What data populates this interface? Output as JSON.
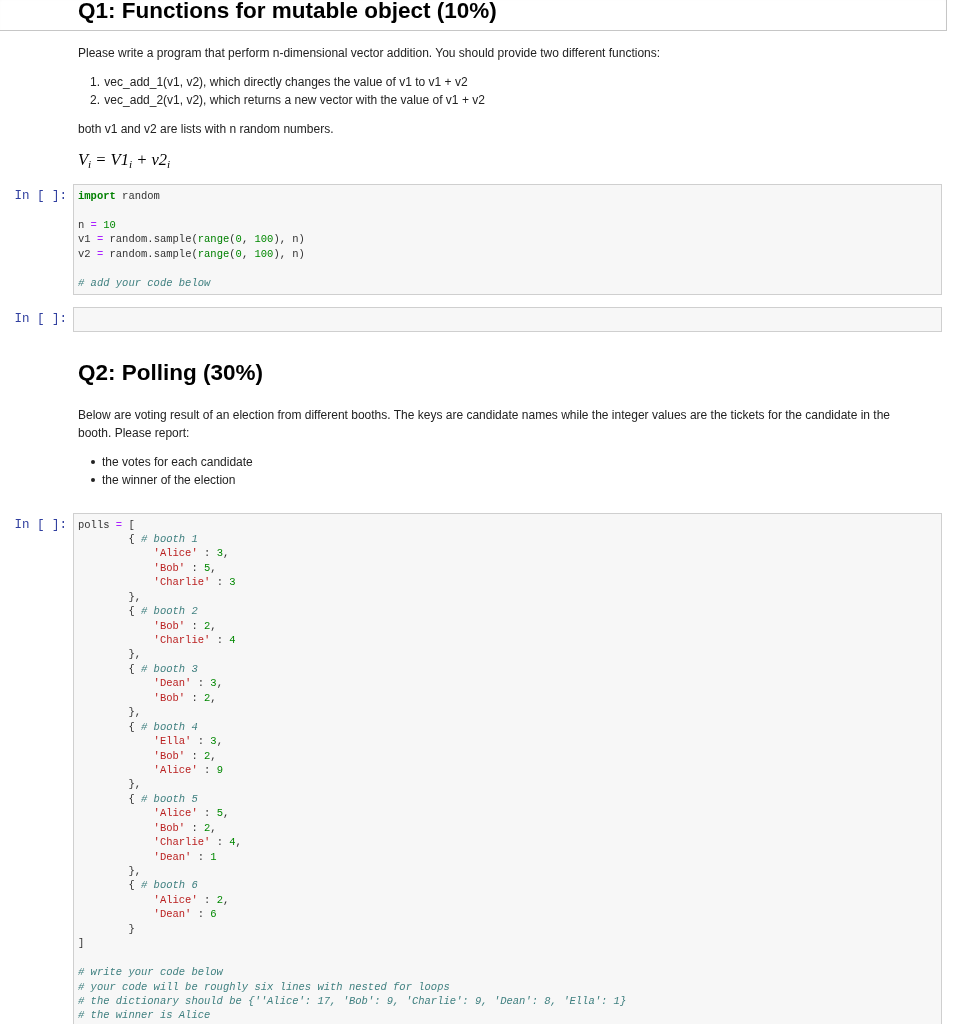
{
  "cells": [
    {
      "kind": "markdown",
      "selected": true,
      "blocks": [
        {
          "kind": "heading",
          "text": "Q1: Functions for mutable object (10%)"
        }
      ]
    },
    {
      "kind": "markdown",
      "selected": false,
      "blocks": [
        {
          "kind": "paragraph",
          "text": "Please write a program that perform n-dimensional vector addition. You should provide two different functions:"
        },
        {
          "kind": "numbered_list",
          "items": [
            {
              "marker": "1.",
              "text": "vec_add_1(v1, v2), which directly changes the value of v1 to v1 + v2"
            },
            {
              "marker": "2.",
              "text": "vec_add_2(v1, v2), which returns a new vector with the value of v1 + v2"
            }
          ]
        },
        {
          "kind": "paragraph",
          "text": "both v1 and v2 are lists with n random numbers."
        },
        {
          "kind": "math",
          "text": "V$_{i}$ = V1$_{i}$ + v2$_{i}$"
        }
      ]
    },
    {
      "kind": "code",
      "selected": false,
      "prompt": "In [ ]:",
      "blocks": [
        [
          [
            {
              "kind": "keyword",
              "text": "import"
            },
            {
              "kind": "plain",
              "text": " random"
            }
          ]
        ],
        [
          [
            {
              "kind": "plain",
              "text": "n "
            },
            {
              "kind": "operator",
              "text": "="
            },
            {
              "kind": "number",
              "text": " 10"
            }
          ],
          [
            {
              "kind": "plain",
              "text": "v1 "
            },
            {
              "kind": "operator",
              "text": "="
            },
            {
              "kind": "plain",
              "text": " random.sample("
            },
            {
              "kind": "builtin",
              "text": "range"
            },
            {
              "kind": "plain",
              "text": "("
            },
            {
              "kind": "number",
              "text": "0"
            },
            {
              "kind": "plain",
              "text": ", "
            },
            {
              "kind": "number",
              "text": "100"
            },
            {
              "kind": "plain",
              "text": "), n)"
            }
          ],
          [
            {
              "kind": "plain",
              "text": "v2 "
            },
            {
              "kind": "operator",
              "text": "="
            },
            {
              "kind": "plain",
              "text": " random.sample("
            },
            {
              "kind": "builtin",
              "text": "range"
            },
            {
              "kind": "plain",
              "text": "("
            },
            {
              "kind": "number",
              "text": "0"
            },
            {
              "kind": "plain",
              "text": ", "
            },
            {
              "kind": "number",
              "text": "100"
            },
            {
              "kind": "plain",
              "text": "), n)"
            }
          ]
        ],
        [
          [
            {
              "kind": "comment",
              "text": "# add your code below"
            }
          ]
        ]
      ]
    },
    {
      "kind": "code",
      "selected": false,
      "prompt": "In [ ]:"
    },
    {
      "kind": "markdown",
      "selected": false,
      "blocks": [
        {
          "kind": "heading",
          "text": "Q2: Polling (30%)"
        },
        {
          "kind": "paragraph",
          "text": "Below are voting result of an election from different booths. The keys are candidate names while the integer values are the tickets for the candidate in the booth. Please report:"
        },
        {
          "kind": "bullet_list",
          "items": [
            "the votes for each candidate",
            "the winner of the election"
          ]
        }
      ]
    },
    {
      "kind": "code",
      "selected": false,
      "prompt": "In [ ]:",
      "blocks": [
        [
          [
            {
              "kind": "plain",
              "text": "polls "
            },
            {
              "kind": "operator",
              "text": "="
            },
            {
              "kind": "plain",
              "text": " ["
            }
          ],
          [
            {
              "kind": "plain",
              "text": "        { "
            },
            {
              "kind": "comment",
              "text": "# booth 1"
            }
          ],
          [
            {
              "kind": "string",
              "text": "            'Alice'"
            },
            {
              "kind": "plain",
              "text": " : "
            },
            {
              "kind": "number",
              "text": "3"
            },
            {
              "kind": "plain",
              "text": ","
            }
          ],
          [
            {
              "kind": "string",
              "text": "            'Bob'"
            },
            {
              "kind": "plain",
              "text": " : "
            },
            {
              "kind": "number",
              "text": "5"
            },
            {
              "kind": "plain",
              "text": ","
            }
          ],
          [
            {
              "kind": "string",
              "text": "            'Charlie'"
            },
            {
              "kind": "plain",
              "text": " : "
            },
            {
              "kind": "number",
              "text": "3"
            }
          ],
          [
            {
              "kind": "plain",
              "text": "        },"
            }
          ],
          [
            {
              "kind": "plain",
              "text": "        { "
            },
            {
              "kind": "comment",
              "text": "# booth 2"
            }
          ],
          [
            {
              "kind": "string",
              "text": "            'Bob'"
            },
            {
              "kind": "plain",
              "text": " : "
            },
            {
              "kind": "number",
              "text": "2"
            },
            {
              "kind": "plain",
              "text": ","
            }
          ],
          [
            {
              "kind": "string",
              "text": "            'Charlie'"
            },
            {
              "kind": "plain",
              "text": " : "
            },
            {
              "kind": "number",
              "text": "4"
            }
          ],
          [
            {
              "kind": "plain",
              "text": "        },"
            }
          ],
          [
            {
              "kind": "plain",
              "text": "        { "
            },
            {
              "kind": "comment",
              "text": "# booth 3"
            }
          ],
          [
            {
              "kind": "string",
              "text": "            'Dean'"
            },
            {
              "kind": "plain",
              "text": " : "
            },
            {
              "kind": "number",
              "text": "3"
            },
            {
              "kind": "plain",
              "text": ","
            }
          ],
          [
            {
              "kind": "string",
              "text": "            'Bob'"
            },
            {
              "kind": "plain",
              "text": " : "
            },
            {
              "kind": "number",
              "text": "2"
            },
            {
              "kind": "plain",
              "text": ","
            }
          ],
          [
            {
              "kind": "plain",
              "text": "        },"
            }
          ],
          [
            {
              "kind": "plain",
              "text": "        { "
            },
            {
              "kind": "comment",
              "text": "# booth 4"
            }
          ],
          [
            {
              "kind": "string",
              "text": "            'Ella'"
            },
            {
              "kind": "plain",
              "text": " : "
            },
            {
              "kind": "number",
              "text": "3"
            },
            {
              "kind": "plain",
              "text": ","
            }
          ],
          [
            {
              "kind": "string",
              "text": "            'Bob'"
            },
            {
              "kind": "plain",
              "text": " : "
            },
            {
              "kind": "number",
              "text": "2"
            },
            {
              "kind": "plain",
              "text": ","
            }
          ],
          [
            {
              "kind": "string",
              "text": "            'Alice'"
            },
            {
              "kind": "plain",
              "text": " : "
            },
            {
              "kind": "number",
              "text": "9"
            }
          ],
          [
            {
              "kind": "plain",
              "text": "        },"
            }
          ],
          [
            {
              "kind": "plain",
              "text": "        { "
            },
            {
              "kind": "comment",
              "text": "# booth 5"
            }
          ],
          [
            {
              "kind": "string",
              "text": "            'Alice'"
            },
            {
              "kind": "plain",
              "text": " : "
            },
            {
              "kind": "number",
              "text": "5"
            },
            {
              "kind": "plain",
              "text": ","
            }
          ],
          [
            {
              "kind": "string",
              "text": "            'Bob'"
            },
            {
              "kind": "plain",
              "text": " : "
            },
            {
              "kind": "number",
              "text": "2"
            },
            {
              "kind": "plain",
              "text": ","
            }
          ],
          [
            {
              "kind": "string",
              "text": "            'Charlie'"
            },
            {
              "kind": "plain",
              "text": " : "
            },
            {
              "kind": "number",
              "text": "4"
            },
            {
              "kind": "plain",
              "text": ","
            }
          ],
          [
            {
              "kind": "string",
              "text": "            'Dean'"
            },
            {
              "kind": "plain",
              "text": " : "
            },
            {
              "kind": "number",
              "text": "1"
            }
          ],
          [
            {
              "kind": "plain",
              "text": "        },"
            }
          ],
          [
            {
              "kind": "plain",
              "text": "        { "
            },
            {
              "kind": "comment",
              "text": "# booth 6"
            }
          ],
          [
            {
              "kind": "string",
              "text": "            'Alice'"
            },
            {
              "kind": "plain",
              "text": " : "
            },
            {
              "kind": "number",
              "text": "2"
            },
            {
              "kind": "plain",
              "text": ","
            }
          ],
          [
            {
              "kind": "string",
              "text": "            'Dean'"
            },
            {
              "kind": "plain",
              "text": " : "
            },
            {
              "kind": "number",
              "text": "6"
            }
          ],
          [
            {
              "kind": "plain",
              "text": "        }"
            }
          ],
          [
            {
              "kind": "plain",
              "text": "]"
            }
          ]
        ],
        [
          [
            {
              "kind": "comment",
              "text": "# write your code below"
            }
          ],
          [
            {
              "kind": "comment",
              "text": "# your code will be roughly six lines with nested for loops"
            }
          ],
          [
            {
              "kind": "comment",
              "text": "# the dictionary should be {''Alice': 17, 'Bob': 9, 'Charlie': 9, 'Dean': 8, 'Ella': 1}"
            }
          ],
          [
            {
              "kind": "comment",
              "text": "# the winner is Alice"
            }
          ]
        ]
      ]
    }
  ]
}
